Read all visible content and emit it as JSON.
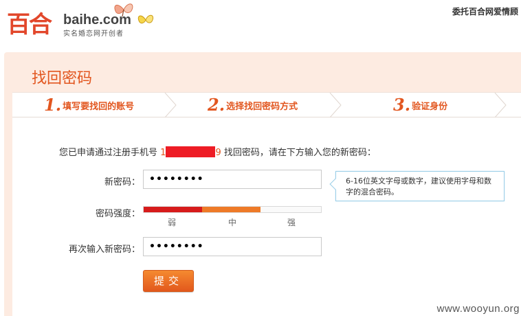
{
  "header": {
    "logo_cn": "百合",
    "logo_en": "baihe.com",
    "logo_sub": "实名婚恋网开创者",
    "top_right_text": "委托百合网爱情顾"
  },
  "page": {
    "title": "找回密码"
  },
  "steps": [
    {
      "num": "1.",
      "label": "填写要找回的账号"
    },
    {
      "num": "2.",
      "label": "选择找回密码方式"
    },
    {
      "num": "3.",
      "label": "验证身份"
    }
  ],
  "form": {
    "intro_prefix": "您已申请通过注册手机号",
    "phone_start": "1",
    "phone_end": "9",
    "intro_suffix": "找回密码，请在下方输入您的新密码：",
    "new_password_label": "新密码：",
    "new_password_value": "••••••••",
    "strength_label": "密码强度：",
    "strength_level": 0.66,
    "strength_ticks": [
      "弱",
      "中",
      "强"
    ],
    "confirm_label": "再次输入新密码：",
    "confirm_value": "••••••••",
    "tooltip": "6-16位英文字母或数字，建议使用字母和数字的混合密码。",
    "submit_label": "提交"
  },
  "watermark": "www.wooyun.org",
  "colors": {
    "accent": "#e2561f",
    "panel_bg": "#fdebe1",
    "tooltip_border": "#9ccfe8",
    "weak": "#d71b1b",
    "medium": "#ee7a28"
  }
}
